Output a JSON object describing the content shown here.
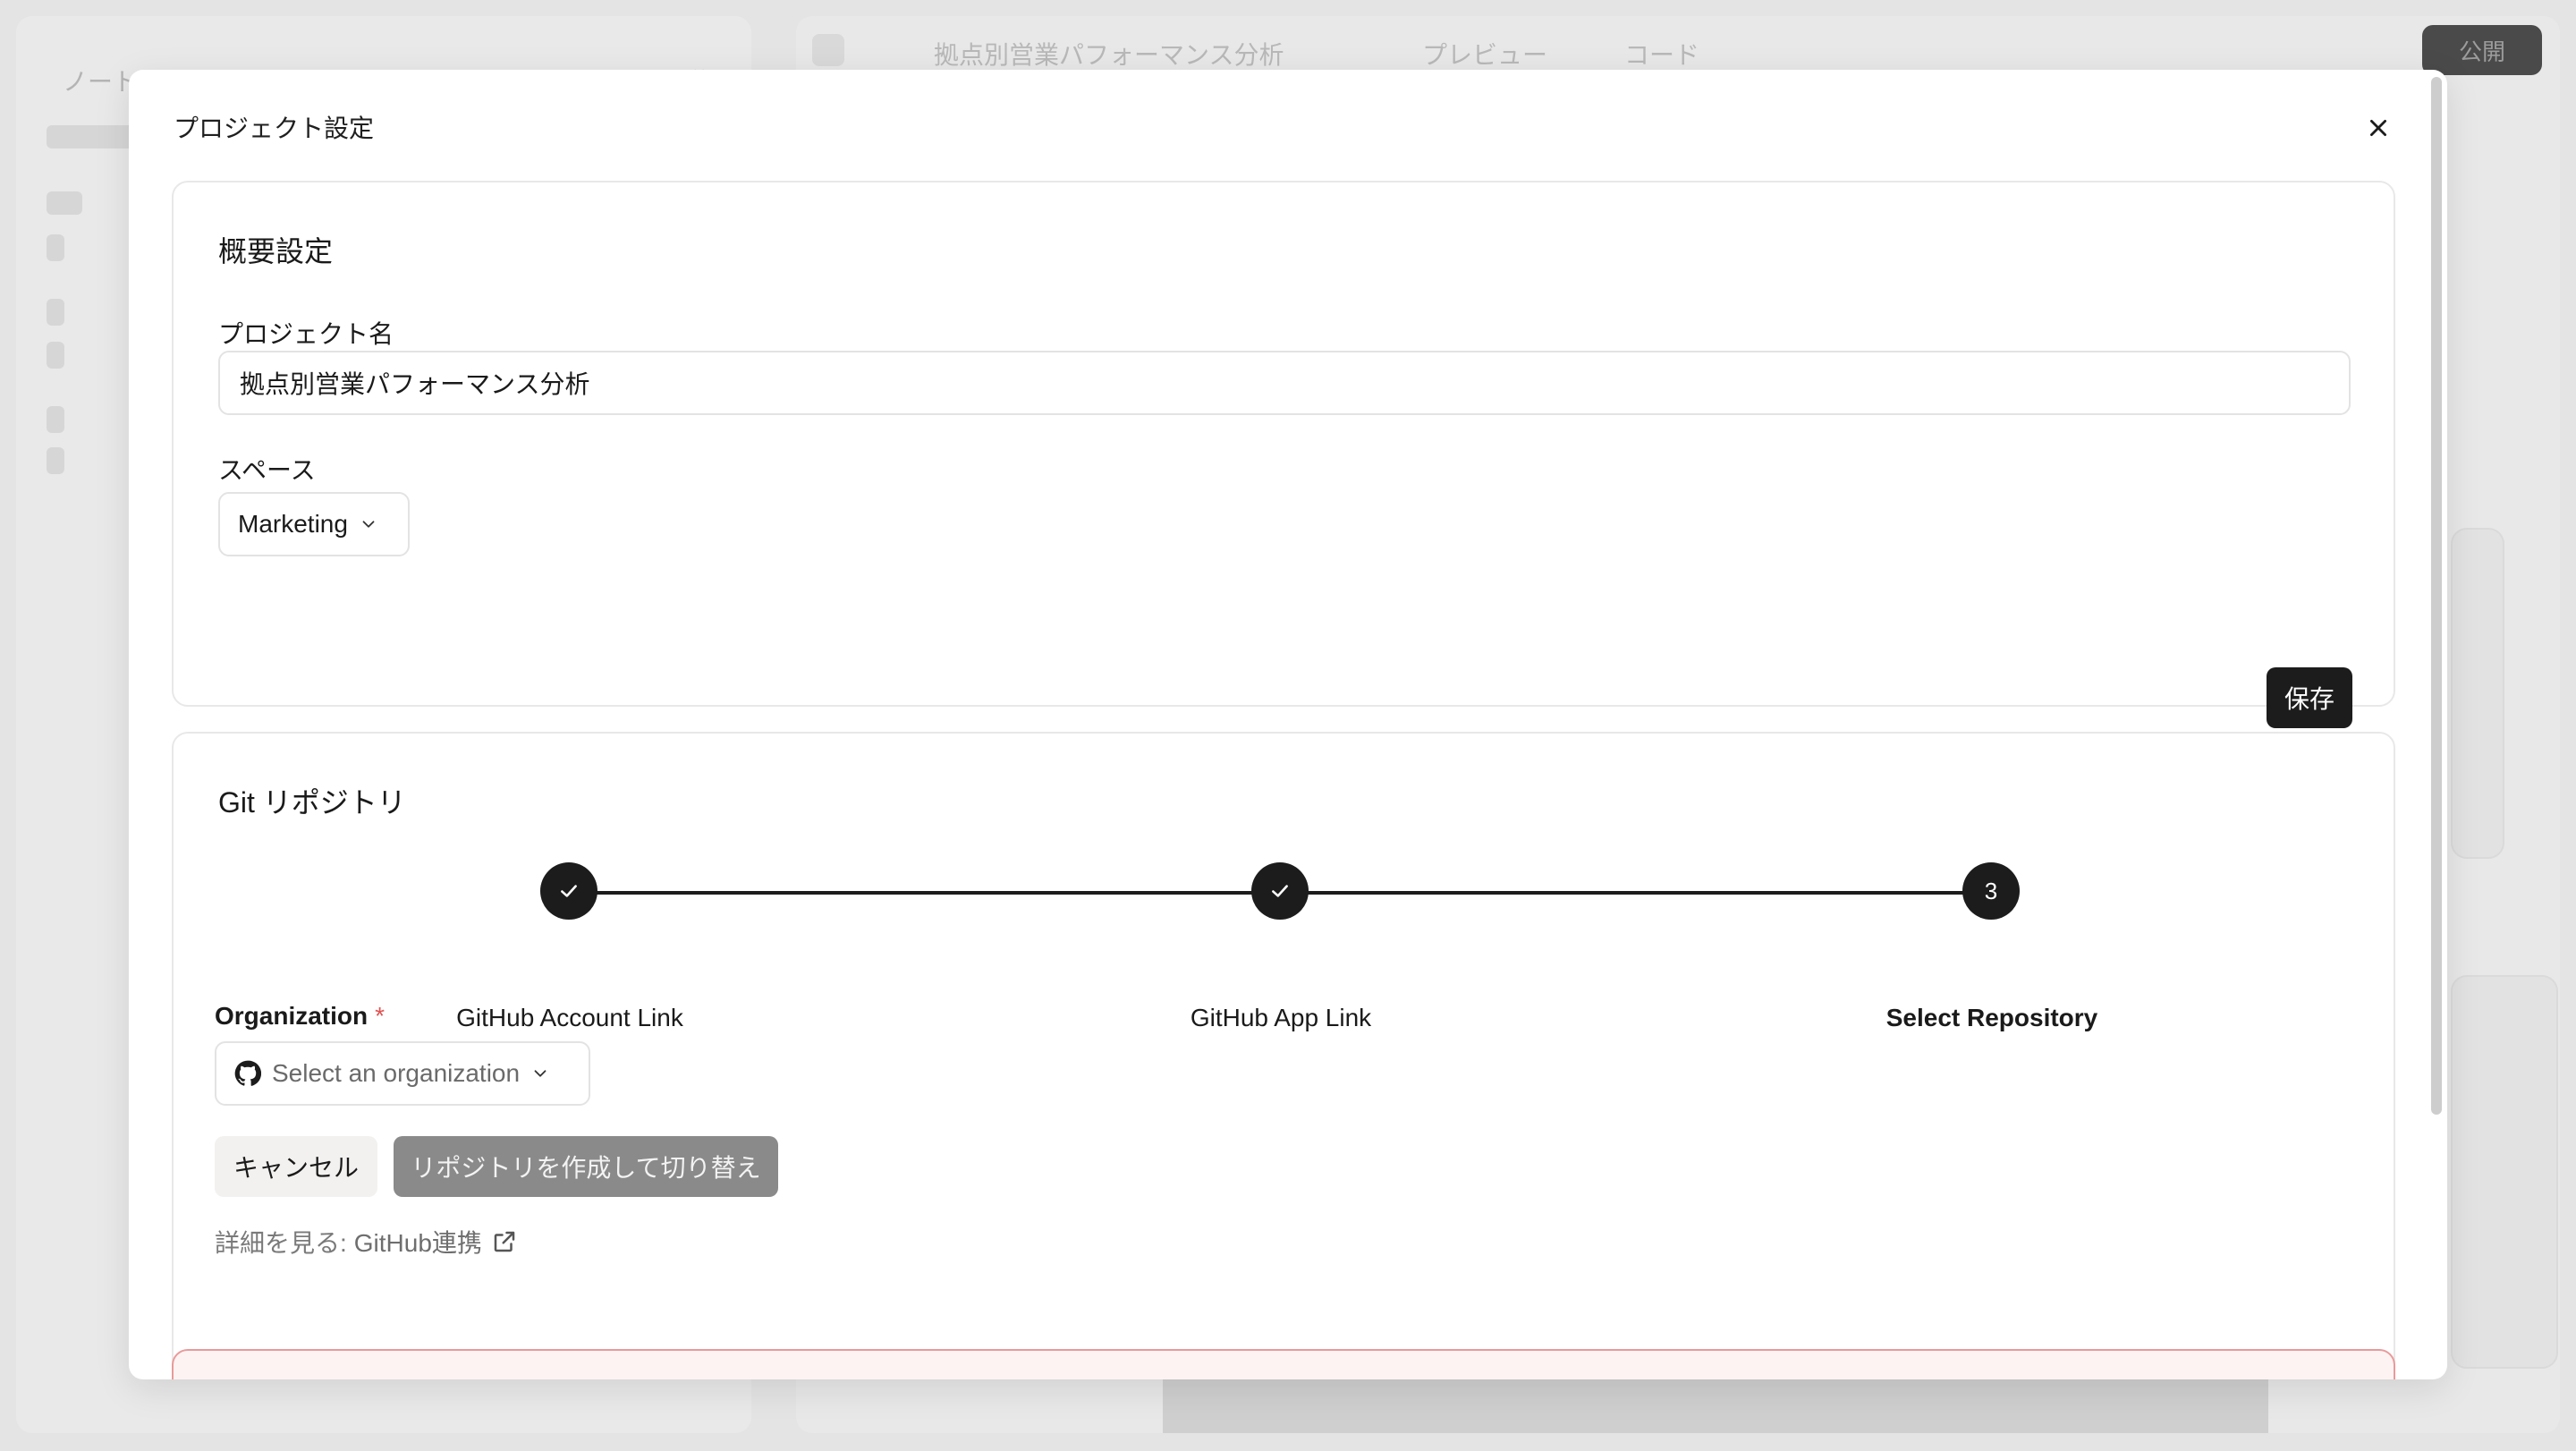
{
  "background": {
    "sidebar_title": "ノート",
    "topbar_project": "拠点別営業パフォーマンス分析",
    "topbar_preview": "プレビュー",
    "topbar_code": "コード",
    "publish_label": "公開"
  },
  "modal": {
    "title": "プロジェクト設定",
    "close_icon": "close-icon"
  },
  "overview": {
    "section_title": "概要設定",
    "project_name_label": "プロジェクト名",
    "project_name_value": "拠点別営業パフォーマンス分析",
    "space_label": "スペース",
    "space_value": "Marketing",
    "save_label": "保存"
  },
  "git": {
    "section_title": "Git リポジトリ",
    "steps": [
      {
        "label": "GitHub Account Link",
        "state": "done"
      },
      {
        "label": "GitHub App Link",
        "state": "done"
      },
      {
        "label": "Select Repository",
        "state": "current",
        "number": "3"
      }
    ],
    "organization_label": "Organization",
    "required_mark": "*",
    "organization_placeholder": "Select an organization",
    "cancel_label": "キャンセル",
    "create_label": "リポジトリを作成して切り替え",
    "learn_more_prefix": "詳細を見る:",
    "learn_more_link": "GitHub連携"
  },
  "colors": {
    "primary": "#1c1c1c",
    "disabled_button": "#8a8a8a",
    "required": "#e05252",
    "danger_border": "#e99a9a"
  }
}
